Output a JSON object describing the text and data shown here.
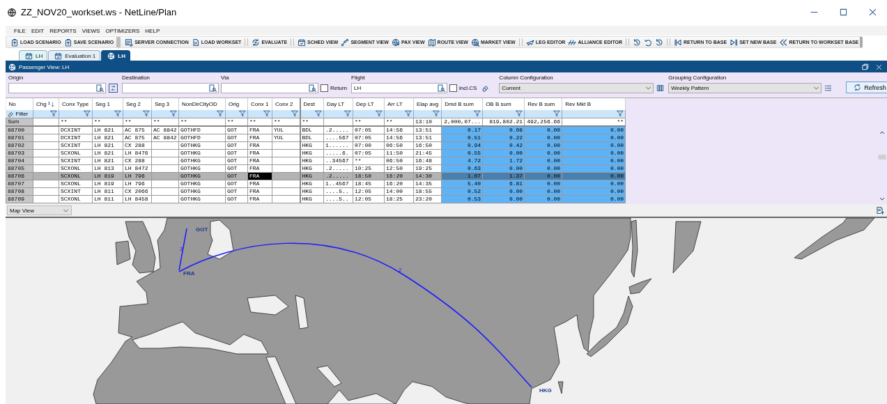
{
  "window": {
    "title": "ZZ_NOV20_workset.ws - NetLine/Plan"
  },
  "menu": [
    "FILE",
    "EDIT",
    "REPORTS",
    "VIEWS",
    "OPTIMIZERS",
    "HELP"
  ],
  "toolbar": {
    "groups": [
      {
        "kind": "labeled",
        "items": [
          "LOAD SCENARIO",
          "SAVE SCENARIO"
        ]
      },
      {
        "kind": "labeled",
        "items": [
          "SERVER CONNECTION",
          "LOAD WORKSET"
        ]
      },
      {
        "kind": "labeled",
        "items": [
          "EVALUATE"
        ]
      },
      {
        "kind": "labeled",
        "items": [
          "SCHED VIEW",
          "SEGMENT VIEW",
          "PAX VIEW",
          "ROUTE VIEW",
          "MARKET VIEW"
        ]
      },
      {
        "kind": "labeled",
        "items": [
          "LEG EDITOR",
          "ALLIANCE EDITOR"
        ]
      },
      {
        "kind": "icons"
      },
      {
        "kind": "labeled",
        "items": [
          "RETURN TO BASE",
          "SET NEW BASE",
          "RETURN TO WORKSET BASE"
        ]
      }
    ]
  },
  "tabs": [
    {
      "label": "LH",
      "selected": false
    },
    {
      "label": "Evaluation 1",
      "selected": false
    },
    {
      "label": "LH",
      "selected": true
    }
  ],
  "panel": {
    "title": "Passenger View: LH"
  },
  "filters": {
    "origin": {
      "label": "Origin"
    },
    "destination": {
      "label": "Destination"
    },
    "via": {
      "label": "Via"
    },
    "return": {
      "label": "Return",
      "checked": false
    },
    "flight": {
      "label": "Flight",
      "value": "LH"
    },
    "incl_cs": {
      "label": "incl.CS",
      "checked": false
    },
    "column_configuration": {
      "label": "Column Configuration",
      "value": "Current"
    },
    "grouping_configuration": {
      "label": "Grouping Configuration",
      "value": "Weekly Pattern"
    },
    "refresh_button": "Refresh"
  },
  "table": {
    "pinned_columns": [
      {
        "label": "No",
        "kind": "index"
      },
      {
        "label": "Chg",
        "kind": "text",
        "sort_order": "1"
      },
      {
        "label": "Conx Type",
        "kind": "text",
        "sum": "**"
      },
      {
        "label": "Seg 1",
        "kind": "text",
        "sum": "**"
      },
      {
        "label": "Seg 2",
        "kind": "text",
        "sum": "**"
      },
      {
        "label": "Seg 3",
        "kind": "text",
        "sum": "**"
      },
      {
        "label": "NonDirCityOD",
        "kind": "text",
        "sum": "**"
      },
      {
        "label": "Orig",
        "kind": "text",
        "sum": "**"
      },
      {
        "label": "Conx 1",
        "kind": "text",
        "sum": "**"
      },
      {
        "label": "Conx 2",
        "kind": "text",
        "sum": "**"
      }
    ],
    "scroll_columns": [
      {
        "label": "Dest",
        "kind": "text",
        "sum": "**"
      },
      {
        "label": "Day LT",
        "kind": "text"
      },
      {
        "label": "Dep LT",
        "kind": "text",
        "sum": "**"
      },
      {
        "label": "Arr LT",
        "kind": "text",
        "sum": "**"
      },
      {
        "label": "Elap avg",
        "kind": "text",
        "sum": "13:10"
      },
      {
        "label": "Dmd B sum",
        "kind": "measure",
        "sum": "2,000,07..."
      },
      {
        "label": "OB B sum",
        "kind": "measure",
        "sum": "819,802.21"
      },
      {
        "label": "Rev B sum",
        "kind": "measure",
        "sum": "492,256.66"
      },
      {
        "label": "Rev Mkt B",
        "kind": "measure",
        "sum": "**"
      }
    ],
    "filter_label": "Filter",
    "sum_label": "Sum",
    "rows": [
      {
        "selected": false,
        "cells": [
          "88700",
          null,
          "DCXINT",
          "LH 821",
          "AC 875",
          "AC 8842",
          "GOTHFD",
          "GOT",
          "FRA",
          "YUL",
          "BDL",
          ".2.....",
          "07:05",
          "14:56",
          "13:51",
          "0.17",
          "0.08",
          "0.00",
          "0.00"
        ]
      },
      {
        "selected": false,
        "cells": [
          "88701",
          null,
          "DCXINT",
          "LH 821",
          "AC 875",
          "AC 8842",
          "GOTHFD",
          "GOT",
          "FRA",
          "YUL",
          "BDL",
          "....567",
          "07:05",
          "14:56",
          "13:51",
          "0.51",
          "0.22",
          "0.00",
          "0.00"
        ]
      },
      {
        "selected": false,
        "cells": [
          "88702",
          null,
          "SCXINT",
          "LH 821",
          "CX 288",
          null,
          "GOTHKG",
          "GOT",
          "FRA",
          null,
          "HKG",
          "1......",
          "07:00",
          "06:50",
          "16:50",
          "0.94",
          "0.42",
          "0.00",
          "0.00"
        ]
      },
      {
        "selected": false,
        "cells": [
          "88703",
          null,
          "SCXONL",
          "LH 821",
          "LH 8476",
          null,
          "GOTHKG",
          "GOT",
          "FRA",
          null,
          "HKG",
          ".....6.",
          "07:05",
          "11:50",
          "21:45",
          "0.55",
          "0.00",
          "0.00",
          "0.00"
        ]
      },
      {
        "selected": false,
        "cells": [
          "88704",
          null,
          "SCXINT",
          "LH 821",
          "CX 288",
          null,
          "GOTHKG",
          "GOT",
          "FRA",
          null,
          "HKG",
          "..34567",
          "**",
          "06:50",
          "16:48",
          "4.72",
          "1.72",
          "0.00",
          "0.00"
        ]
      },
      {
        "selected": false,
        "cells": [
          "88705",
          null,
          "SCXONL",
          "LH 813",
          "LH 8472",
          null,
          "GOTHKG",
          "GOT",
          "FRA",
          null,
          "HKG",
          ".2.....",
          "10:25",
          "12:50",
          "19:25",
          "0.63",
          "0.00",
          "0.00",
          "0.00"
        ]
      },
      {
        "selected": true,
        "cells": [
          "88706",
          null,
          "SCXONL",
          "LH 819",
          "LH 796",
          null,
          "GOTHKG",
          "GOT",
          {
            "text": "FRA",
            "focused": true
          },
          null,
          "HKG",
          ".2.....",
          "18:50",
          "16:20",
          "14:30",
          "1.07",
          "1.37",
          "0.00",
          "0.00"
        ]
      },
      {
        "selected": false,
        "cells": [
          "88707",
          null,
          "SCXONL",
          "LH 819",
          "LH 796",
          null,
          "GOTHKG",
          "GOT",
          "FRA",
          null,
          "HKG",
          "1..4567",
          "18:45",
          "16:20",
          "14:35",
          "5.40",
          "6.81",
          "0.00",
          "0.00"
        ]
      },
      {
        "selected": false,
        "cells": [
          "88708",
          null,
          "SCXINT",
          "LH 811",
          "CX 2066",
          null,
          "GOTHKG",
          "GOT",
          "FRA",
          null,
          "HKG",
          "....5..",
          "12:05",
          "14:00",
          "18:55",
          "0.52",
          "0.00",
          "0.00",
          "0.00"
        ]
      },
      {
        "selected": false,
        "cells": [
          "88709",
          null,
          "SCXONL",
          "LH 811",
          "LH 8458",
          null,
          "GOTHKG",
          "GOT",
          "FRA",
          null,
          "HKG",
          "....5..",
          "12:05",
          "18:25",
          "23:20",
          "0.53",
          "0.00",
          "0.00",
          "0.00"
        ]
      }
    ]
  },
  "map_view": {
    "mode": "Map View",
    "airports": [
      "GOT",
      "FRA",
      "HKG"
    ],
    "routes": [
      {
        "label": "2"
      },
      {
        "label": "2"
      }
    ]
  }
}
